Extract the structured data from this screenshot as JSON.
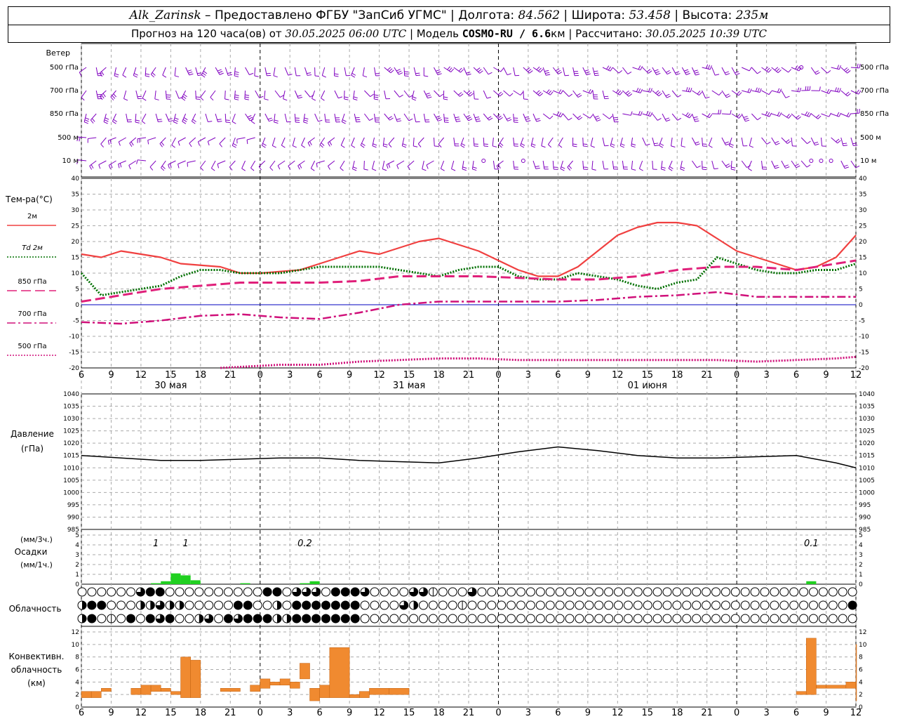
{
  "header": {
    "station": "Alk_Zarinsk",
    "provided_by": " – Предоставлено ФГБУ \"ЗапСиб УГМС\"",
    "lon_label": "Долгота:",
    "lon": "84.562",
    "lat_label": "Широта:",
    "lat": "53.458",
    "alt_label": "Высота:",
    "alt": "235м",
    "forecast_label": "Прогноз на 120 часа(ов) от",
    "issue_time": "30.05.2025 06:00 UTC",
    "model_label": "Модель",
    "model": "COSMO-RU / 6.6",
    "model_unit": "км",
    "calc_label": "Рассчитано:",
    "calc_time": "30.05.2025 10:39 UTC"
  },
  "colors": {
    "wind": "#8000c0",
    "t2m": "#f04040",
    "td2m": "#007000",
    "t850": "#e0207a",
    "t700": "#d0107a",
    "t500": "#d0107a",
    "pressure": "#000000",
    "precip": "#20d020",
    "convective": "#f08a30",
    "grid": "#aaaaaa",
    "zero_line": "#0000c0"
  },
  "time_axis": {
    "tick_labels": [
      "6",
      "9",
      "12",
      "15",
      "18",
      "21",
      "0",
      "3",
      "6",
      "9",
      "12",
      "15",
      "18",
      "21",
      "0",
      "3",
      "6",
      "9",
      "12",
      "15",
      "18",
      "21",
      "0",
      "3",
      "6",
      "9",
      "12"
    ],
    "dates": [
      {
        "label": "30 мая",
        "hour_index": 9
      },
      {
        "label": "31 мая",
        "hour_index": 33
      },
      {
        "label": "01 июня",
        "hour_index": 57
      }
    ]
  },
  "wind_panel": {
    "title": "Ветер",
    "levels": [
      "500 гПа",
      "700 гПа",
      "850 гПа",
      "500 м",
      "10  м"
    ]
  },
  "temp_panel": {
    "title": "Тем-ра(°С)",
    "legend": [
      {
        "label": "2м",
        "style": "solid",
        "color": "#f04040"
      },
      {
        "label": "Td  2м",
        "style": "dotted",
        "color": "#007000"
      },
      {
        "label": "850 гПа",
        "style": "long-dash",
        "color": "#e0207a"
      },
      {
        "label": "700 гПа",
        "style": "dash-dot",
        "color": "#d0107a"
      },
      {
        "label": "500 гПа",
        "style": "dotted",
        "color": "#d0107a"
      }
    ],
    "y_ticks": [
      "40",
      "35",
      "30",
      "25",
      "20",
      "15",
      "10",
      "5",
      "0",
      "-5",
      "-10",
      "-15",
      "-20"
    ]
  },
  "pressure_panel": {
    "title": "Давление",
    "unit": "(гПа)",
    "y_ticks": [
      "1040",
      "1035",
      "1030",
      "1025",
      "1020",
      "1015",
      "1010",
      "1005",
      "1000",
      "995",
      "990",
      "985"
    ]
  },
  "precip_panel": {
    "unit_3h": "(мм/3ч.)",
    "title": "Осадки",
    "unit_1h": "(мм/1ч.)",
    "y_ticks": [
      "5",
      "4",
      "3",
      "2",
      "1",
      "0"
    ],
    "annotations": [
      {
        "text": "1",
        "hour_index": 7.5
      },
      {
        "text": "1",
        "hour_index": 10.5
      },
      {
        "text": "0.2",
        "hour_index": 22.5
      },
      {
        "text": "0.1",
        "hour_index": 73.5
      }
    ]
  },
  "cloud_panel": {
    "title": "Облачность"
  },
  "convective_panel": {
    "title_1": "Конвективн.",
    "title_2": "облачность",
    "unit": "(км)",
    "y_ticks": [
      "12",
      "10",
      "8",
      "6",
      "4",
      "2",
      "0"
    ]
  },
  "chart_data": {
    "type": "line",
    "x_unit": "hours from 30.05.2025 06:00 UTC",
    "x_range": [
      0,
      78
    ],
    "temperature": {
      "ylim": [
        -20,
        40
      ],
      "series": [
        {
          "name": "2м",
          "x": [
            0,
            2,
            4,
            6,
            8,
            10,
            12,
            14,
            16,
            18,
            20,
            22,
            24,
            26,
            28,
            30,
            32,
            34,
            36,
            38,
            40,
            42,
            44,
            46,
            48,
            50,
            52,
            54,
            56,
            58,
            60,
            62,
            64,
            66,
            68,
            70,
            72,
            74,
            76,
            78
          ],
          "values": [
            16,
            15,
            17,
            16,
            15,
            13,
            12.5,
            12,
            10,
            10,
            10.5,
            11,
            13,
            15,
            17,
            16,
            18,
            20,
            21,
            19,
            17,
            14,
            11,
            9,
            9,
            12,
            17,
            22,
            24.5,
            26,
            26,
            25,
            21,
            17,
            15,
            13,
            11,
            12,
            15,
            22
          ]
        },
        {
          "name": "Td  2м",
          "x": [
            0,
            2,
            4,
            6,
            8,
            10,
            12,
            14,
            16,
            18,
            20,
            22,
            24,
            26,
            28,
            30,
            32,
            34,
            36,
            38,
            40,
            42,
            44,
            46,
            48,
            50,
            52,
            54,
            56,
            58,
            60,
            62,
            64,
            66,
            68,
            70,
            72,
            74,
            76,
            78
          ],
          "values": [
            10,
            3,
            4,
            5,
            6,
            9,
            11,
            11,
            10,
            10,
            10,
            11,
            12,
            12,
            12,
            12,
            11,
            10,
            9,
            11,
            12,
            12,
            9,
            8,
            8,
            10,
            9,
            8,
            6,
            5,
            7,
            8,
            15,
            13,
            11,
            10,
            10,
            11,
            11,
            13
          ]
        },
        {
          "name": "850 гПа",
          "x": [
            0,
            4,
            8,
            12,
            16,
            20,
            24,
            28,
            32,
            36,
            40,
            44,
            48,
            52,
            56,
            60,
            64,
            68,
            72,
            76,
            78
          ],
          "values": [
            1,
            3,
            5,
            6,
            7,
            7,
            7,
            7.5,
            9,
            9,
            9,
            8.5,
            8,
            8,
            9,
            11,
            12,
            12,
            11,
            13,
            14
          ]
        },
        {
          "name": "700 гПа",
          "x": [
            0,
            4,
            8,
            12,
            16,
            20,
            24,
            28,
            32,
            36,
            40,
            44,
            48,
            52,
            56,
            60,
            64,
            68,
            72,
            76,
            78
          ],
          "values": [
            -5.5,
            -6,
            -5,
            -3.5,
            -3,
            -4,
            -4.5,
            -2.5,
            0,
            1,
            1,
            1,
            1,
            1.5,
            2.5,
            3,
            4,
            2.5,
            2.5,
            2.5,
            2.5
          ]
        },
        {
          "name": "500 гПа",
          "x": [
            14,
            20,
            24,
            28,
            32,
            36,
            40,
            44,
            48,
            52,
            56,
            60,
            64,
            68,
            72,
            76,
            78
          ],
          "values": [
            -20,
            -19,
            -19,
            -18,
            -17.5,
            -17,
            -17,
            -17.5,
            -17.5,
            -17.5,
            -17.5,
            -17.5,
            -17.5,
            -18,
            -17.5,
            -17,
            -16.5
          ]
        }
      ]
    },
    "pressure": {
      "ylim": [
        985,
        1040
      ],
      "x": [
        0,
        4,
        8,
        12,
        16,
        20,
        24,
        28,
        32,
        36,
        40,
        44,
        48,
        52,
        56,
        60,
        64,
        68,
        72,
        76,
        78
      ],
      "values": [
        1015,
        1014,
        1013,
        1013,
        1013.5,
        1014,
        1014,
        1013,
        1012.5,
        1012,
        1014,
        1016.5,
        1018.5,
        1017,
        1015,
        1014,
        1014,
        1014.5,
        1015,
        1012,
        1010
      ]
    },
    "precipitation": {
      "ylim": [
        0,
        5
      ],
      "x": [
        7,
        8,
        9,
        10,
        11,
        16,
        22,
        23,
        73
      ],
      "values": [
        0.1,
        0.3,
        1.1,
        0.9,
        0.4,
        0.1,
        0.1,
        0.3,
        0.3
      ]
    },
    "convective": {
      "ylim": [
        0,
        12
      ],
      "bars": [
        [
          0,
          1,
          1.5,
          2.5
        ],
        [
          1,
          2,
          1.5,
          2.5
        ],
        [
          2,
          3,
          2.5,
          3
        ],
        [
          5,
          6,
          2,
          3
        ],
        [
          6,
          7,
          2,
          3.5
        ],
        [
          7,
          8,
          2.5,
          3.5
        ],
        [
          8,
          9,
          2.5,
          3
        ],
        [
          9,
          10,
          2,
          2.5
        ],
        [
          10,
          11,
          1.5,
          8
        ],
        [
          11,
          12,
          1.5,
          7.5
        ],
        [
          14,
          16,
          2.5,
          3
        ],
        [
          17,
          18,
          2.5,
          3.5
        ],
        [
          18,
          19,
          3,
          4.5
        ],
        [
          19,
          20,
          3.5,
          4
        ],
        [
          20,
          21,
          3.5,
          4.5
        ],
        [
          21,
          22,
          3,
          4
        ],
        [
          22,
          23,
          4.5,
          7
        ],
        [
          23,
          24,
          1,
          3
        ],
        [
          24,
          25,
          1.5,
          3.5
        ],
        [
          25,
          27,
          1.5,
          9.5
        ],
        [
          27,
          28,
          1.5,
          2
        ],
        [
          28,
          29,
          1.5,
          2.5
        ],
        [
          29,
          31,
          2,
          3
        ],
        [
          31,
          33,
          2,
          3
        ],
        [
          72,
          73,
          2,
          2.5
        ],
        [
          73,
          74,
          2,
          11
        ],
        [
          74,
          75,
          3,
          3.5
        ],
        [
          75,
          77,
          3,
          3.5
        ],
        [
          77,
          78,
          3,
          4
        ],
        [
          78,
          79,
          1,
          10
        ]
      ]
    },
    "cloudiness": {
      "rows": [
        "0000003440000000000440333044430000331000300000000000000000000000000000000000000002",
        "2440002232200000440020444444400003200001000000000000000000000000000000000000000442",
        "2401040434002304344422444444400000000000000000000000000000000000000000000000000000"
      ]
    },
    "wind": {
      "levels": [
        "500 гПа",
        "700 гПа",
        "850 гПа",
        "500 м",
        "10  м"
      ],
      "points_per_level": 78
    }
  }
}
